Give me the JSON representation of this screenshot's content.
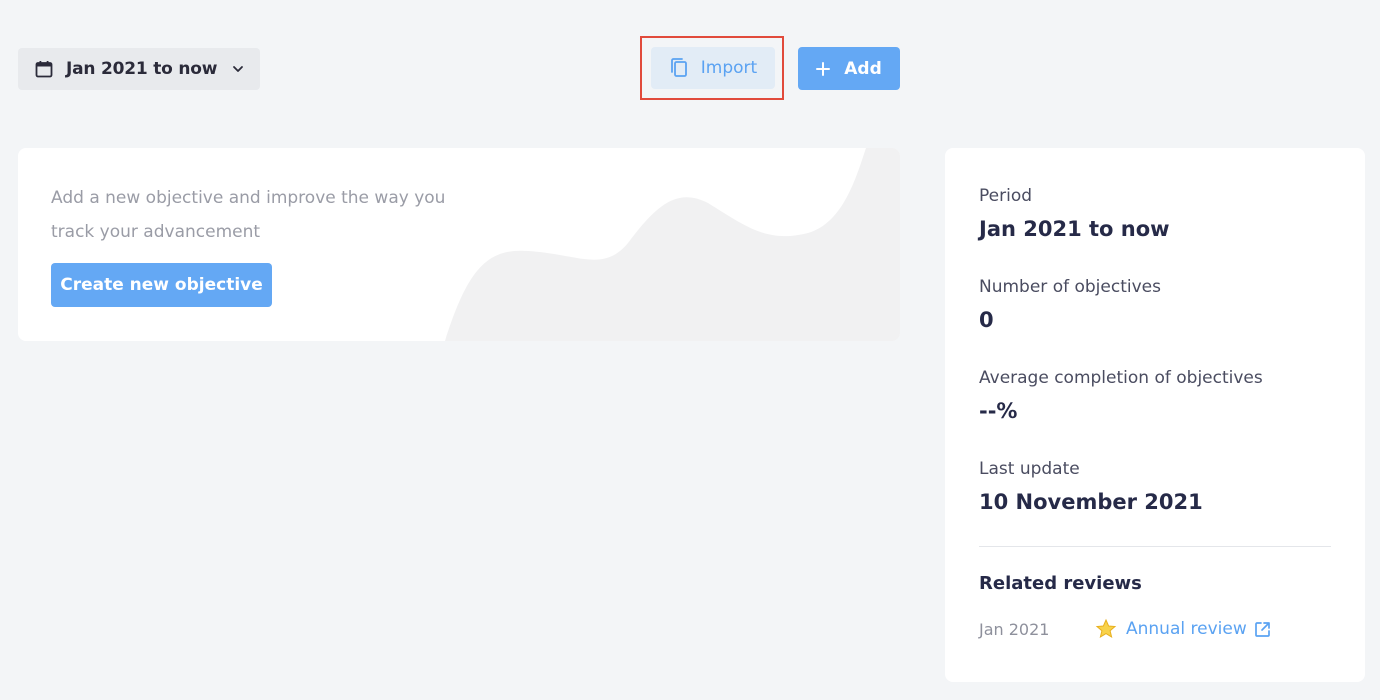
{
  "toolbar": {
    "period_label": "Jan 2021 to now",
    "import_label": "Import",
    "add_label": "Add"
  },
  "empty_state": {
    "message": "Add a new objective and improve the way you track your advancement",
    "create_label": "Create new objective"
  },
  "summary": {
    "period_label": "Period",
    "period_value": "Jan 2021 to now",
    "count_label": "Number of objectives",
    "count_value": "0",
    "completion_label": "Average completion of objectives",
    "completion_value": "--%",
    "update_label": "Last update",
    "update_value": "10 November 2021",
    "related_title": "Related reviews",
    "reviews": [
      {
        "date": "Jan 2021",
        "title": "Annual review"
      }
    ]
  },
  "colors": {
    "accent": "#64a8f4",
    "link": "#5aa2f2",
    "highlight": "#e14a3b",
    "background": "#f3f5f7"
  },
  "icons": {
    "period": "calendar-icon",
    "dropdown": "chevron-down-icon",
    "import": "copy-icon",
    "add": "plus-icon",
    "review": "star-icon",
    "open": "external-link-icon"
  }
}
